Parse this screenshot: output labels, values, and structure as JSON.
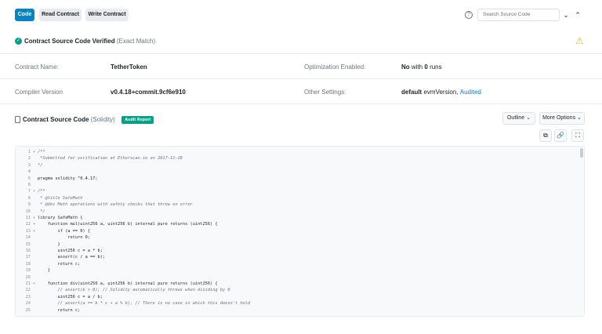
{
  "tabs": {
    "code": "Code",
    "read": "Read Contract",
    "write": "Write Contract"
  },
  "search": {
    "placeholder": "Search Source Code"
  },
  "verified": {
    "title": "Contract Source Code Verified",
    "sub": "(Exact Match)"
  },
  "info": {
    "contract_name_label": "Contract Name:",
    "contract_name_value": "TetherToken",
    "optimization_label": "Optimization Enabled:",
    "optimization_value_bold": "No",
    "optimization_value_with": "with",
    "optimization_value_runs": "0",
    "optimization_value_suffix": "runs",
    "compiler_label": "Compiler Version",
    "compiler_value": "v0.4.18+commit.9cf6e910",
    "other_label": "Other Settings:",
    "other_value_bold": "default",
    "other_value_evm": "evmVersion,",
    "other_value_link": "Audited"
  },
  "source": {
    "title": "Contract Source Code",
    "sub": "(Solidity)",
    "badge": "Audit Report",
    "outline_label": "Outline",
    "more_options_label": "More Options"
  },
  "colors": {
    "primary": "#0784c3",
    "success": "#00a186",
    "warning": "#f5b70a"
  },
  "code_lines": [
    {
      "n": "1",
      "fold": "▾",
      "text": "/**",
      "comment": true
    },
    {
      "n": "2",
      "fold": "",
      "text": " *Submitted for verification at Etherscan.io on 2017-11-28",
      "comment": true
    },
    {
      "n": "3",
      "fold": "",
      "text": "*/",
      "comment": true
    },
    {
      "n": "4",
      "fold": "",
      "text": "",
      "comment": false
    },
    {
      "n": "5",
      "fold": "",
      "text": "pragma solidity ^0.4.17;",
      "comment": false
    },
    {
      "n": "6",
      "fold": "",
      "text": "",
      "comment": false
    },
    {
      "n": "7",
      "fold": "▾",
      "text": "/**",
      "comment": true
    },
    {
      "n": "8",
      "fold": "",
      "text": " * @title SafeMath",
      "comment": true
    },
    {
      "n": "9",
      "fold": "",
      "text": " * @dev Math operations with safety checks that throw on error",
      "comment": true
    },
    {
      "n": "10",
      "fold": "",
      "text": " */",
      "comment": true
    },
    {
      "n": "11",
      "fold": "▾",
      "text": "library SafeMath {",
      "comment": false
    },
    {
      "n": "12",
      "fold": "▾",
      "text": "    function mul(uint256 a, uint256 b) internal pure returns (uint256) {",
      "comment": false
    },
    {
      "n": "13",
      "fold": "▾",
      "text": "        if (a == 0) {",
      "comment": false
    },
    {
      "n": "14",
      "fold": "",
      "text": "            return 0;",
      "comment": false
    },
    {
      "n": "15",
      "fold": "",
      "text": "        }",
      "comment": false
    },
    {
      "n": "16",
      "fold": "",
      "text": "        uint256 c = a * b;",
      "comment": false
    },
    {
      "n": "17",
      "fold": "",
      "text": "        assert(c / a == b);",
      "comment": false
    },
    {
      "n": "18",
      "fold": "",
      "text": "        return c;",
      "comment": false
    },
    {
      "n": "19",
      "fold": "",
      "text": "    }",
      "comment": false
    },
    {
      "n": "20",
      "fold": "",
      "text": "",
      "comment": false
    },
    {
      "n": "21",
      "fold": "▾",
      "text": "    function div(uint256 a, uint256 b) internal pure returns (uint256) {",
      "comment": false
    },
    {
      "n": "22",
      "fold": "",
      "text": "        // assert(b > 0); // Solidity automatically throws when dividing by 0",
      "comment": true
    },
    {
      "n": "23",
      "fold": "",
      "text": "        uint256 c = a / b;",
      "comment": false
    },
    {
      "n": "24",
      "fold": "",
      "text": "        // assert(a == b * c + a % b); // There is no case in which this doesn't hold",
      "comment": true
    },
    {
      "n": "25",
      "fold": "",
      "text": "        return c;",
      "comment": false
    }
  ]
}
